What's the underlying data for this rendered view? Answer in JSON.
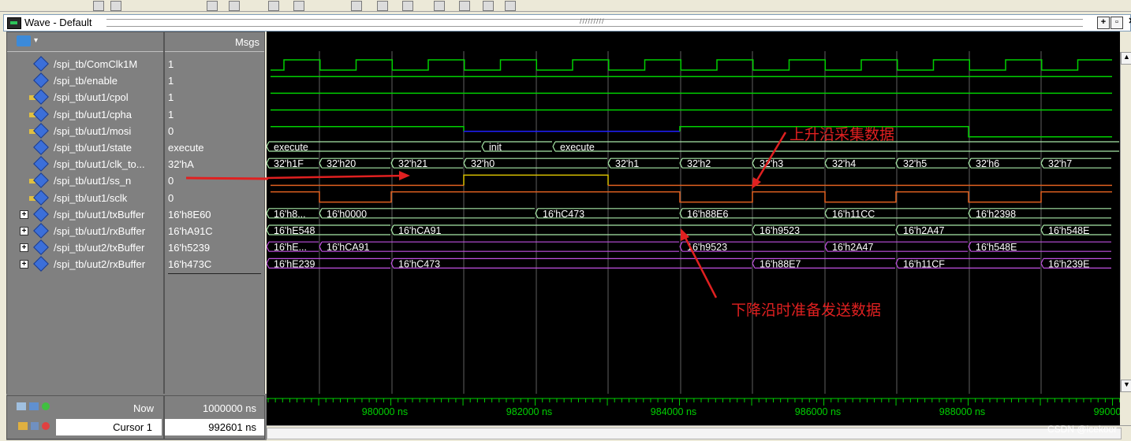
{
  "window": {
    "title": "Wave - Default"
  },
  "header": {
    "msgs_label": "Msgs"
  },
  "signals": [
    {
      "name": "/spi_tb/ComClk1M",
      "value": "1",
      "expandable": false,
      "dir": "in"
    },
    {
      "name": "/spi_tb/enable",
      "value": "1",
      "expandable": false,
      "dir": "in"
    },
    {
      "name": "/spi_tb/uut1/cpol",
      "value": "1",
      "expandable": false,
      "dir": "inout"
    },
    {
      "name": "/spi_tb/uut1/cpha",
      "value": "1",
      "expandable": false,
      "dir": "inout"
    },
    {
      "name": "/spi_tb/uut1/mosi",
      "value": "0",
      "expandable": false,
      "dir": "out"
    },
    {
      "name": "/spi_tb/uut1/state",
      "value": "execute",
      "expandable": false,
      "dir": "in"
    },
    {
      "name": "/spi_tb/uut1/clk_to...",
      "value": "32'hA",
      "expandable": false,
      "dir": "in"
    },
    {
      "name": "/spi_tb/uut1/ss_n",
      "value": "0",
      "expandable": false,
      "dir": "out"
    },
    {
      "name": "/spi_tb/uut1/sclk",
      "value": "0",
      "expandable": false,
      "dir": "out"
    },
    {
      "name": "/spi_tb/uut1/txBuffer",
      "value": "16'h8E60",
      "expandable": true,
      "dir": "in"
    },
    {
      "name": "/spi_tb/uut1/rxBuffer",
      "value": "16'hA91C",
      "expandable": true,
      "dir": "in"
    },
    {
      "name": "/spi_tb/uut2/txBuffer",
      "value": "16'h5239",
      "expandable": true,
      "dir": "in"
    },
    {
      "name": "/spi_tb/uut2/rxBuffer",
      "value": "16'h473C",
      "expandable": true,
      "dir": "in"
    }
  ],
  "waves": {
    "state": [
      {
        "t0": 0,
        "t1": 273,
        "label": "execute"
      },
      {
        "t0": 273,
        "t1": 363,
        "label": "init"
      },
      {
        "t0": 363,
        "t1": 1082,
        "label": "execute"
      }
    ],
    "clk_to": [
      {
        "t0": 0,
        "t1": 67,
        "label": "32'h1F"
      },
      {
        "t0": 67,
        "t1": 158,
        "label": "32'h20"
      },
      {
        "t0": 158,
        "t1": 250,
        "label": "32'h21"
      },
      {
        "t0": 250,
        "t1": 433,
        "label": "32'h0"
      },
      {
        "t0": 433,
        "t1": 524,
        "label": "32'h1"
      },
      {
        "t0": 524,
        "t1": 616,
        "label": "32'h2"
      },
      {
        "t0": 616,
        "t1": 708,
        "label": "32'h3"
      },
      {
        "t0": 708,
        "t1": 798,
        "label": "32'h4"
      },
      {
        "t0": 798,
        "t1": 890,
        "label": "32'h5"
      },
      {
        "t0": 890,
        "t1": 982,
        "label": "32'h6"
      },
      {
        "t0": 982,
        "t1": 1072,
        "label": "32'h7"
      }
    ],
    "uut1_tx": [
      {
        "t0": 0,
        "t1": 67,
        "label": "16'h8..."
      },
      {
        "t0": 67,
        "t1": 341,
        "label": "16'h0000"
      },
      {
        "t0": 341,
        "t1": 524,
        "label": "16'hC473"
      },
      {
        "t0": 524,
        "t1": 708,
        "label": "16'h88E6"
      },
      {
        "t0": 708,
        "t1": 890,
        "label": "16'h11CC"
      },
      {
        "t0": 890,
        "t1": 1072,
        "label": "16'h2398"
      }
    ],
    "uut1_rx": [
      {
        "t0": 0,
        "t1": 158,
        "label": "16'hE548"
      },
      {
        "t0": 158,
        "t1": 616,
        "label": "16'hCA91"
      },
      {
        "t0": 616,
        "t1": 798,
        "label": "16'h9523"
      },
      {
        "t0": 798,
        "t1": 982,
        "label": "16'h2A47"
      },
      {
        "t0": 982,
        "t1": 1072,
        "label": "16'h548E"
      }
    ],
    "uut2_tx": [
      {
        "t0": 0,
        "t1": 67,
        "label": "16'hE..."
      },
      {
        "t0": 67,
        "t1": 524,
        "label": "16'hCA91"
      },
      {
        "t0": 524,
        "t1": 708,
        "label": "16'h9523"
      },
      {
        "t0": 708,
        "t1": 890,
        "label": "16'h2A47"
      },
      {
        "t0": 890,
        "t1": 1072,
        "label": "16'h548E"
      }
    ],
    "uut2_rx": [
      {
        "t0": 0,
        "t1": 158,
        "label": "16'hE239"
      },
      {
        "t0": 158,
        "t1": 616,
        "label": "16'hC473"
      },
      {
        "t0": 616,
        "t1": 798,
        "label": "16'h88E7"
      },
      {
        "t0": 798,
        "t1": 982,
        "label": "16'h11CF"
      },
      {
        "t0": 982,
        "t1": 1072,
        "label": "16'h239E"
      }
    ]
  },
  "annotations": {
    "rising_edge": "上升沿采集数据",
    "falling_edge": "下降沿时准备发送数据"
  },
  "footer": {
    "now_label": "Now",
    "now_value": "1000000 ns",
    "cursor_label": "Cursor 1",
    "cursor_value": "992601 ns",
    "timeline_labels": [
      "980000 ns",
      "982000 ns",
      "984000 ns",
      "986000 ns",
      "988000 ns",
      "99000"
    ]
  },
  "watermark": "CSDN @icekoor",
  "colors": {
    "wave_green": "#00d000",
    "bus_green": "#a8e8a8",
    "blue": "#2020ff",
    "yellow": "#d8c000",
    "orange": "#e06020",
    "purple": "#c050e0",
    "annotation_red": "#e02020"
  }
}
